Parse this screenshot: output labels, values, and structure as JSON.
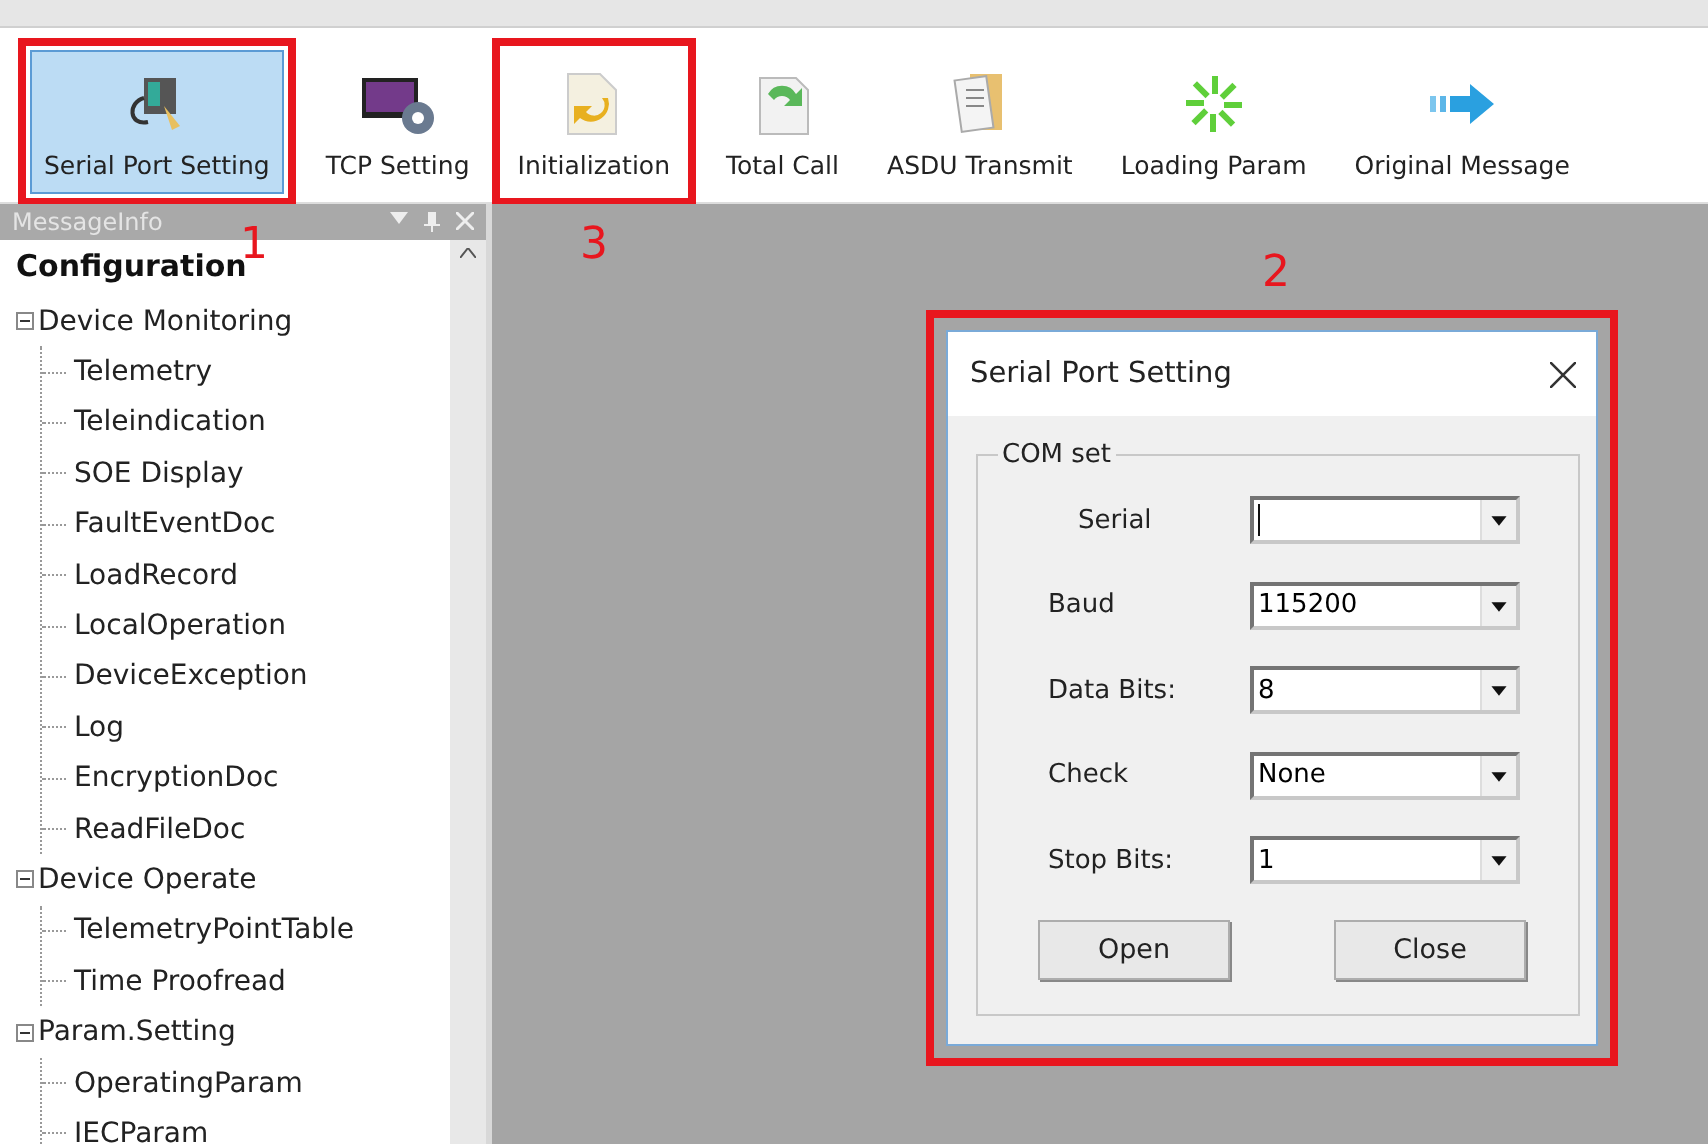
{
  "toolbar": [
    {
      "label": "Serial Port Setting",
      "selected": true,
      "highlighted": true
    },
    {
      "label": "TCP Setting",
      "selected": false,
      "highlighted": false
    },
    {
      "label": "Initialization",
      "selected": false,
      "highlighted": true
    },
    {
      "label": "Total Call",
      "selected": false,
      "highlighted": false
    },
    {
      "label": "ASDU Transmit",
      "selected": false,
      "highlighted": false
    },
    {
      "label": "Loading Param",
      "selected": false,
      "highlighted": false
    },
    {
      "label": "Original Message",
      "selected": false,
      "highlighted": false
    }
  ],
  "panel": {
    "title": "MessageInfo",
    "heading": "Configuration",
    "tree": [
      {
        "label": "Device Monitoring",
        "expanded": true,
        "children": [
          {
            "label": "Telemetry"
          },
          {
            "label": "Teleindication"
          },
          {
            "label": "SOE Display"
          },
          {
            "label": "FaultEventDoc"
          },
          {
            "label": "LoadRecord"
          },
          {
            "label": "LocalOperation"
          },
          {
            "label": "DeviceException"
          },
          {
            "label": "Log"
          },
          {
            "label": "EncryptionDoc"
          },
          {
            "label": "ReadFileDoc"
          }
        ]
      },
      {
        "label": "Device Operate",
        "expanded": true,
        "children": [
          {
            "label": "TelemetryPointTable"
          },
          {
            "label": "Time Proofread"
          }
        ]
      },
      {
        "label": "Param.Setting",
        "expanded": true,
        "children": [
          {
            "label": "OperatingParam"
          },
          {
            "label": "IECParam"
          }
        ]
      }
    ]
  },
  "dialog": {
    "title": "Serial Port Setting",
    "highlighted": true,
    "group": "COM set",
    "fields": [
      {
        "label": "Serial"
      },
      {
        "label": "Baud",
        "value": "115200"
      },
      {
        "label": "Data Bits:",
        "value": "8"
      },
      {
        "label": "Check",
        "value": "None"
      },
      {
        "label": "Stop Bits:",
        "value": "1"
      }
    ],
    "buttons": [
      "Open",
      "Close"
    ]
  },
  "annotations": [
    "1",
    "2",
    "3"
  ]
}
